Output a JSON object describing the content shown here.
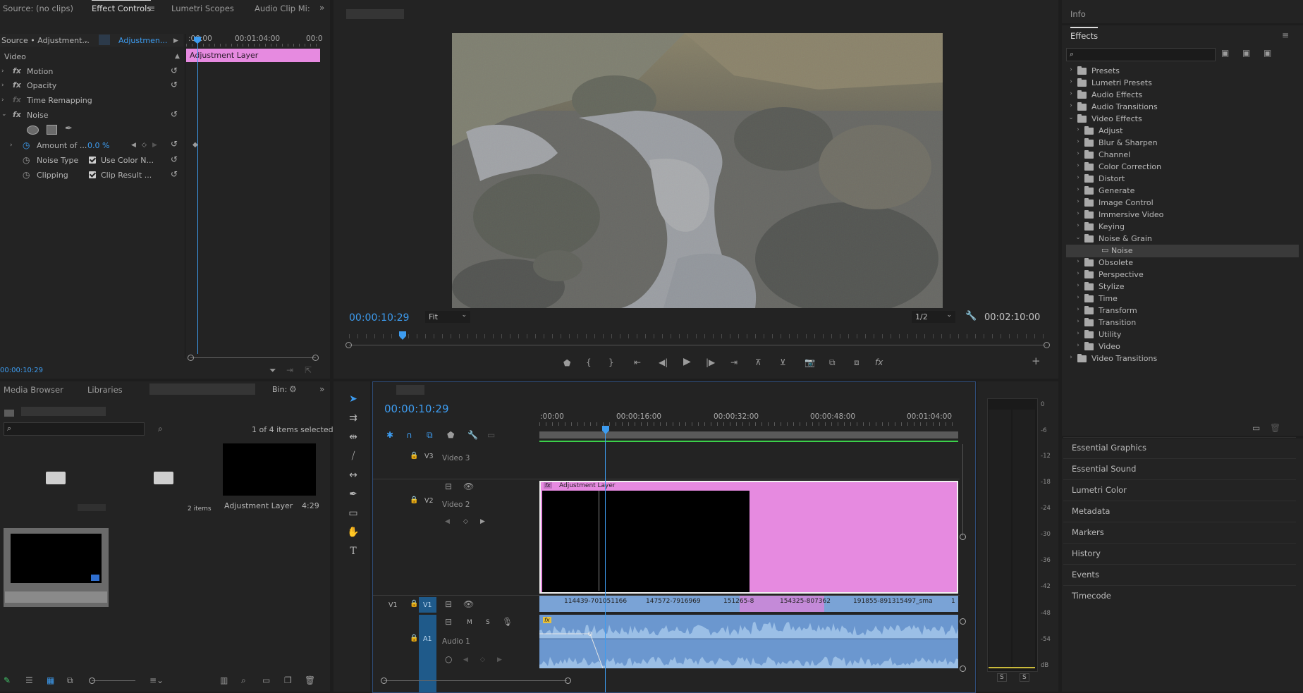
{
  "effect_controls": {
    "tabs": [
      "Source: (no clips)",
      "Effect Controls",
      "Lumetri Scopes",
      "Audio Clip Mi:"
    ],
    "source_label": "Source • Adjustment...",
    "clip_label": "Adjustmen...",
    "ruler_start": ":00:00",
    "ruler_mid": "00:01:04:00",
    "ruler_end": "00:0",
    "clip_bar": "Adjustment Layer",
    "video_header": "Video",
    "props": [
      {
        "fx": "fx",
        "name": "Motion"
      },
      {
        "fx": "fx",
        "name": "Opacity"
      },
      {
        "fx": "fx",
        "name": "Time Remapping"
      },
      {
        "fx": "fx",
        "name": "Noise"
      }
    ],
    "amount_label": "Amount of ...",
    "amount_value": "0.0 %",
    "noise_type_label": "Noise Type",
    "use_color_label": "Use Color N...",
    "clipping_label": "Clipping",
    "clip_result_label": "Clip Result ...",
    "timecode": "00:00:10:29"
  },
  "program": {
    "timecode": "00:00:10:29",
    "fit": "Fit",
    "quality": "1/2",
    "duration": "00:02:10:00",
    "fx_btn": "fx"
  },
  "project": {
    "tabs": [
      "Media Browser",
      "Libraries"
    ],
    "bin_label": "Bin:",
    "selection": "1 of 4 items selected",
    "items_count": "2 items",
    "adj_name": "Adjustment Layer",
    "adj_duration": "4:29"
  },
  "timeline": {
    "timecode": "00:00:10:29",
    "ruler": [
      ":00:00",
      "00:00:16:00",
      "00:00:32:00",
      "00:00:48:00",
      "00:01:04:00"
    ],
    "v3_code": "V3",
    "v3_name": "Video 3",
    "v2_code": "V2",
    "v2_name": "Video 2",
    "v1_src": "V1",
    "v1_code": "V1",
    "a1_code": "A1",
    "a1_name": "Audio 1",
    "adj_clip": "Adjustment Layer",
    "fx_badge": "fx",
    "m_label": "M",
    "s_label": "S",
    "clips": [
      "114439-701051166",
      "147572-7916969",
      "151265-8",
      "154325-807362",
      "191855-891315497_sma",
      "1"
    ]
  },
  "meter": {
    "labels": [
      "0",
      "-6",
      "-12",
      "-18",
      "-24",
      "-30",
      "-36",
      "-42",
      "-48",
      "-54",
      "dB"
    ],
    "solo": [
      "S",
      "S"
    ]
  },
  "effects": {
    "info_tab": "Info",
    "title": "Effects",
    "tree": [
      {
        "label": "Presets",
        "level": 0,
        "open": false
      },
      {
        "label": "Lumetri Presets",
        "level": 0,
        "open": false
      },
      {
        "label": "Audio Effects",
        "level": 0,
        "open": false
      },
      {
        "label": "Audio Transitions",
        "level": 0,
        "open": false
      },
      {
        "label": "Video Effects",
        "level": 0,
        "open": true
      },
      {
        "label": "Adjust",
        "level": 1,
        "open": false
      },
      {
        "label": "Blur & Sharpen",
        "level": 1,
        "open": false
      },
      {
        "label": "Channel",
        "level": 1,
        "open": false
      },
      {
        "label": "Color Correction",
        "level": 1,
        "open": false
      },
      {
        "label": "Distort",
        "level": 1,
        "open": false
      },
      {
        "label": "Generate",
        "level": 1,
        "open": false
      },
      {
        "label": "Image Control",
        "level": 1,
        "open": false
      },
      {
        "label": "Immersive Video",
        "level": 1,
        "open": false
      },
      {
        "label": "Keying",
        "level": 1,
        "open": false
      },
      {
        "label": "Noise & Grain",
        "level": 1,
        "open": true
      },
      {
        "label": "Noise",
        "level": 2,
        "open": false,
        "selected": true
      },
      {
        "label": "Obsolete",
        "level": 1,
        "open": false
      },
      {
        "label": "Perspective",
        "level": 1,
        "open": false
      },
      {
        "label": "Stylize",
        "level": 1,
        "open": false
      },
      {
        "label": "Time",
        "level": 1,
        "open": false
      },
      {
        "label": "Transform",
        "level": 1,
        "open": false
      },
      {
        "label": "Transition",
        "level": 1,
        "open": false
      },
      {
        "label": "Utility",
        "level": 1,
        "open": false
      },
      {
        "label": "Video",
        "level": 1,
        "open": false
      },
      {
        "label": "Video Transitions",
        "level": 0,
        "open": false
      }
    ],
    "sections": [
      "Essential Graphics",
      "Essential Sound",
      "Lumetri Color",
      "Metadata",
      "Markers",
      "History",
      "Events",
      "Timecode"
    ]
  },
  "colors": {
    "accent": "#3d9cf0",
    "adjustment": "#e68ae0",
    "clip_blue": "#7aa3d6",
    "panel": "#232323"
  }
}
